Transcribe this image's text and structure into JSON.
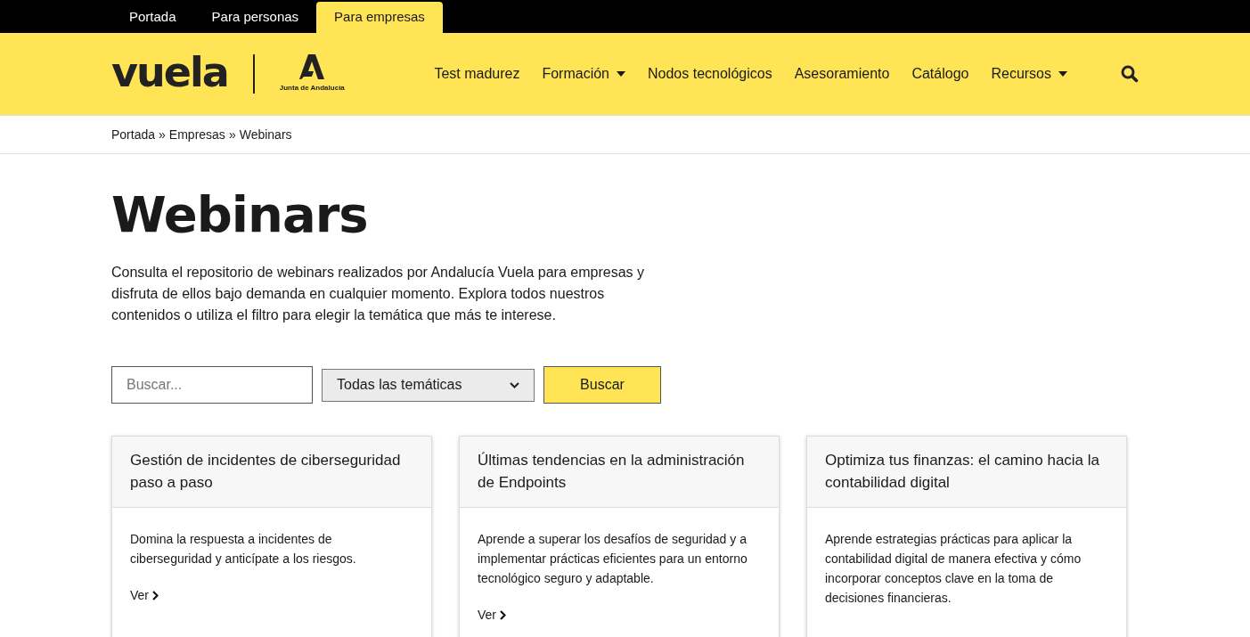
{
  "top_tabs": [
    {
      "label": "Portada",
      "selected": false
    },
    {
      "label": "Para personas",
      "selected": false
    },
    {
      "label": "Para empresas",
      "selected": true
    }
  ],
  "logo": {
    "brand": "vuela",
    "partner": "Junta de Andalucía"
  },
  "nav": [
    {
      "label": "Test madurez",
      "dropdown": false
    },
    {
      "label": "Formación",
      "dropdown": true
    },
    {
      "label": "Nodos tecnológicos",
      "dropdown": false
    },
    {
      "label": "Asesoramiento",
      "dropdown": false
    },
    {
      "label": "Catálogo",
      "dropdown": false
    },
    {
      "label": "Recursos",
      "dropdown": true
    }
  ],
  "breadcrumb": [
    "Portada",
    "Empresas",
    "Webinars"
  ],
  "breadcrumb_separator": "»",
  "title": "Webinars",
  "intro": "Consulta el repositorio de webinars realizados por Andalucía Vuela para empresas y disfruta de ellos bajo demanda en cualquier momento. Explora todos nuestros contenidos o utiliza el filtro para elegir la temática que más te interese.",
  "search": {
    "placeholder": "Buscar...",
    "filter": "Todas las temáticas",
    "button": "Buscar"
  },
  "cards": [
    {
      "title": "Gestión de incidentes de ciberseguridad paso a paso",
      "text": "Domina la respuesta a incidentes de ciberseguridad y anticípate a los riesgos.",
      "link": "Ver"
    },
    {
      "title": "Últimas tendencias en la administración de Endpoints",
      "text": "Aprende a superar los desafíos de seguridad y a implementar prácticas eficientes para un entorno tecnológico seguro y adaptable.",
      "link": "Ver"
    },
    {
      "title": "Optimiza tus finanzas: el camino hacia la contabilidad digital",
      "text": "Aprende estrategias prácticas para aplicar la contabilidad digital de manera efectiva y cómo incorporar conceptos clave en la toma de decisiones financieras."
    }
  ]
}
